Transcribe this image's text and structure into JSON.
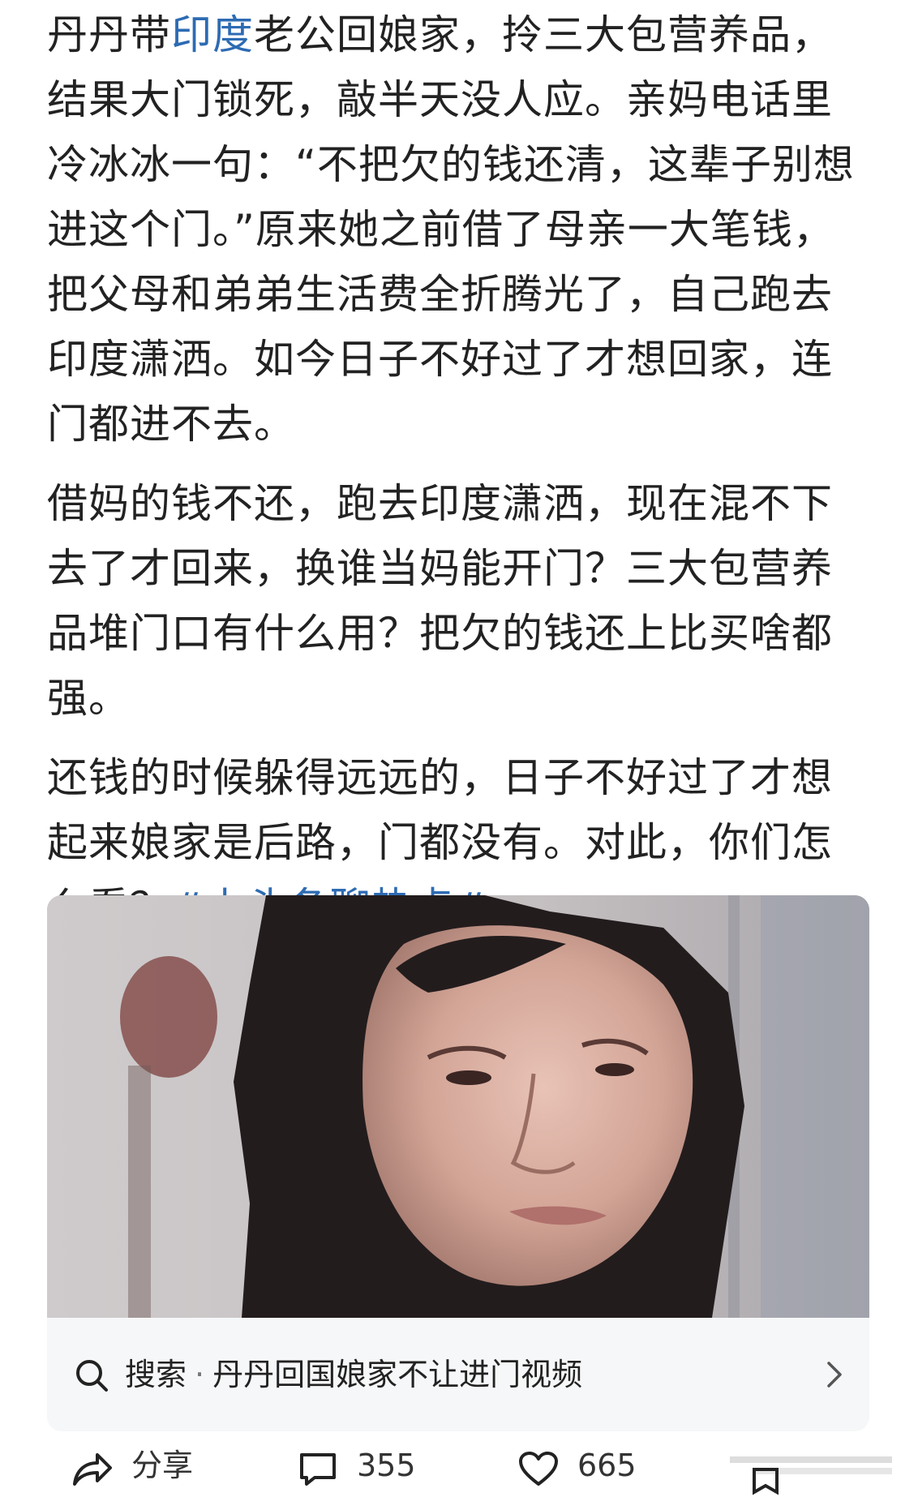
{
  "post": {
    "p1_before": "丹丹带",
    "p1_link": "印度",
    "p1_after": "老公回娘家，拎三大包营养品，结果大门锁死，敲半天没人应。亲妈电话里冷冰冰一句：“不把欠的钱还清，这辈子别想进这个门。”原来她之前借了母亲一大笔钱，把父母和弟弟生活费全折腾光了，自己跑去印度潇洒。如今日子不好过了才想回家，连门都进不去。",
    "p2": "借妈的钱不还，跑去印度潇洒，现在混不下去了才回来，换谁当妈能开门？三大包营养品堆门口有什么用？把欠的钱还上比买啥都强。",
    "p3_before": "还钱的时候躲得远远的，日子不好过了才想起来娘家是后路，门都没有。对此，你们怎么看？",
    "p3_hashtag": "#上头条聊热点#"
  },
  "search": {
    "label": "搜索",
    "separator": "·",
    "query": "丹丹回国娘家不让进门视频"
  },
  "actions": {
    "share_label": "分享",
    "comment_count": "355",
    "like_count": "665"
  },
  "colors": {
    "link": "#2d6bb3",
    "text": "#222222",
    "search_bg": "#f6f7f8"
  },
  "icons": {
    "search": "magnifier-icon",
    "chevron": "chevron-right-icon",
    "share": "share-arrow-icon",
    "comment": "comment-bubble-icon",
    "like": "heart-icon",
    "more": "more-icon"
  }
}
